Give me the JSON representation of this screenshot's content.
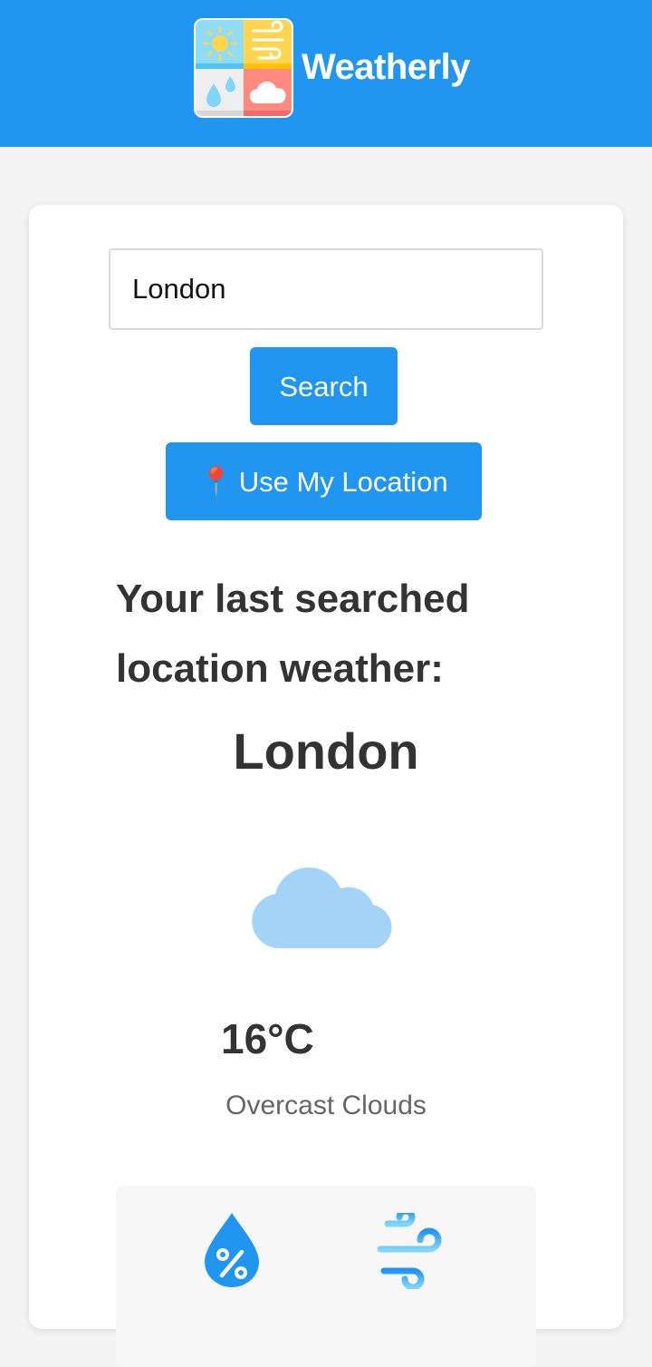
{
  "app": {
    "brand": "Weatherly",
    "accent_color": "#2196f0"
  },
  "search": {
    "value": "London",
    "placeholder": "",
    "search_label": "Search",
    "location_label": "Use My Location",
    "location_icon": "pin-icon"
  },
  "weather": {
    "heading": "Your last searched location weather:",
    "city": "London",
    "icon": "cloud-icon",
    "temperature": "16°C",
    "condition": "Overcast Clouds"
  },
  "details": {
    "items": [
      {
        "icon": "humidity-icon"
      },
      {
        "icon": "wind-icon"
      }
    ]
  }
}
